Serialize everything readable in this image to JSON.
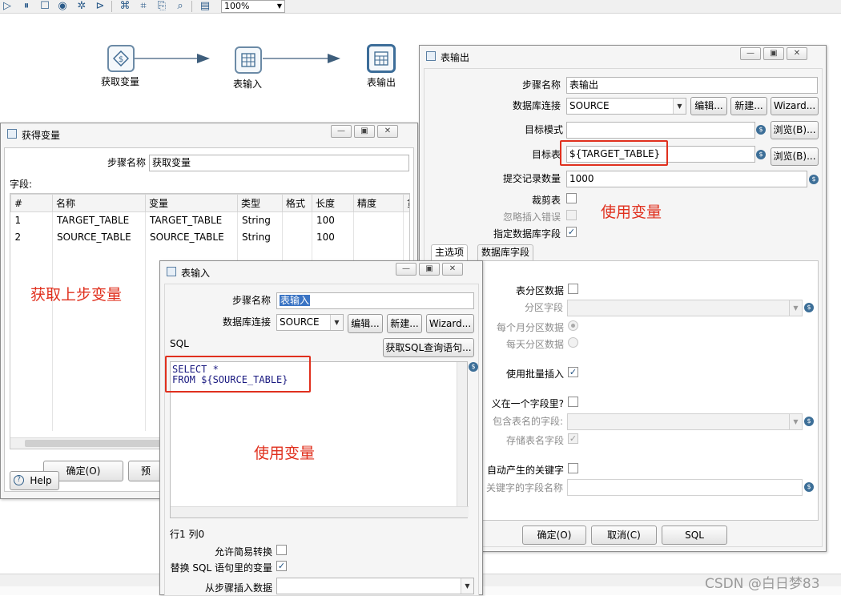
{
  "toolbar": {
    "icons": [
      "play-icon",
      "pause-icon",
      "stop-icon",
      "preview-icon",
      "debug-icon",
      "replay-icon",
      "verify-icon",
      "impact-icon",
      "sql-icon",
      "explore-db-icon",
      "align-icon"
    ],
    "zoom": "100%"
  },
  "flow": {
    "nodes": [
      {
        "label": "获取变量"
      },
      {
        "label": "表输入"
      },
      {
        "label": "表输出"
      }
    ]
  },
  "get_vars_dialog": {
    "title": "获得变量",
    "step_name_label": "步骤名称",
    "step_name_value": "获取变量",
    "fields_label": "字段:",
    "columns": [
      "#",
      "名称",
      "变量",
      "类型",
      "格式",
      "长度",
      "精度",
      "货"
    ],
    "rows": [
      [
        "1",
        "TARGET_TABLE",
        "TARGET_TABLE",
        "String",
        "",
        "100",
        ""
      ],
      [
        "2",
        "SOURCE_TABLE",
        "SOURCE_TABLE",
        "String",
        "",
        "100",
        ""
      ]
    ],
    "ok_label": "确定(O)",
    "preview_label": "预",
    "help_label": "Help",
    "annotation": "获取上步变量"
  },
  "table_input_dialog": {
    "title": "表输入",
    "step_name_label": "步骤名称",
    "step_name_value": "表输入",
    "db_label": "数据库连接",
    "db_value": "SOURCE",
    "edit_label": "编辑...",
    "new_label": "新建...",
    "wizard_label": "Wizard...",
    "sql_label": "SQL",
    "get_sql_label": "获取SQL查询语句...",
    "sql_line1": "SELECT *",
    "sql_line2": "FROM ${SOURCE_TABLE}",
    "annotation": "使用变量",
    "position": "行1 列0",
    "lazy_conversion_label": "允许简易转换",
    "replace_vars_label": "替换 SQL 语句里的变量",
    "insert_from_step_label": "从步骤插入数据",
    "lazy_conversion_checked": false,
    "replace_vars_checked": true
  },
  "table_output_dialog": {
    "title": "表输出",
    "step_name_label": "步骤名称",
    "step_name_value": "表输出",
    "db_label": "数据库连接",
    "db_value": "SOURCE",
    "edit_label": "编辑...",
    "new_label": "新建...",
    "wizard_label": "Wizard...",
    "target_schema_label": "目标模式",
    "target_schema_value": "",
    "browse_label": "浏览(B)...",
    "target_table_label": "目标表",
    "target_table_value": "${TARGET_TABLE}",
    "commit_size_label": "提交记录数量",
    "commit_size_value": "1000",
    "truncate_label": "裁剪表",
    "ignore_errors_label": "忽略插入错误",
    "specify_fields_label": "指定数据库字段",
    "annotation": "使用变量",
    "tabs": [
      "主选项",
      "数据库字段"
    ],
    "partition_label": "表分区数据",
    "partition_field_label": "分区字段",
    "partition_monthly_label": "每个月分区数据",
    "partition_daily_label": "每天分区数据",
    "batch_insert_label": "使用批量插入",
    "table_in_field_label": "义在一个字段里?",
    "table_name_field_label": "包含表名的字段:",
    "store_table_name_label": "存储表名字段",
    "return_keys_label": "自动产生的关键字",
    "key_field_name_label": "关键字的字段名称",
    "ok_label": "确定(O)",
    "cancel_label": "取消(C)",
    "sql_label": "SQL"
  },
  "watermark": "CSDN @白日梦83"
}
